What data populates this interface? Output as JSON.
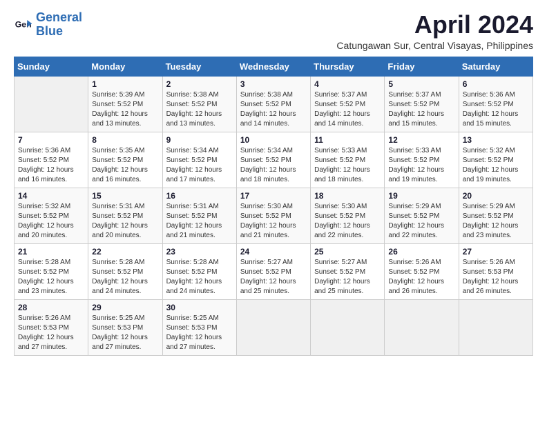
{
  "header": {
    "logo_line1": "General",
    "logo_line2": "Blue",
    "title": "April 2024",
    "subtitle": "Catungawan Sur, Central Visayas, Philippines"
  },
  "calendar": {
    "days_of_week": [
      "Sunday",
      "Monday",
      "Tuesday",
      "Wednesday",
      "Thursday",
      "Friday",
      "Saturday"
    ],
    "weeks": [
      [
        {
          "day": "",
          "info": ""
        },
        {
          "day": "1",
          "info": "Sunrise: 5:39 AM\nSunset: 5:52 PM\nDaylight: 12 hours\nand 13 minutes."
        },
        {
          "day": "2",
          "info": "Sunrise: 5:38 AM\nSunset: 5:52 PM\nDaylight: 12 hours\nand 13 minutes."
        },
        {
          "day": "3",
          "info": "Sunrise: 5:38 AM\nSunset: 5:52 PM\nDaylight: 12 hours\nand 14 minutes."
        },
        {
          "day": "4",
          "info": "Sunrise: 5:37 AM\nSunset: 5:52 PM\nDaylight: 12 hours\nand 14 minutes."
        },
        {
          "day": "5",
          "info": "Sunrise: 5:37 AM\nSunset: 5:52 PM\nDaylight: 12 hours\nand 15 minutes."
        },
        {
          "day": "6",
          "info": "Sunrise: 5:36 AM\nSunset: 5:52 PM\nDaylight: 12 hours\nand 15 minutes."
        }
      ],
      [
        {
          "day": "7",
          "info": "Sunrise: 5:36 AM\nSunset: 5:52 PM\nDaylight: 12 hours\nand 16 minutes."
        },
        {
          "day": "8",
          "info": "Sunrise: 5:35 AM\nSunset: 5:52 PM\nDaylight: 12 hours\nand 16 minutes."
        },
        {
          "day": "9",
          "info": "Sunrise: 5:34 AM\nSunset: 5:52 PM\nDaylight: 12 hours\nand 17 minutes."
        },
        {
          "day": "10",
          "info": "Sunrise: 5:34 AM\nSunset: 5:52 PM\nDaylight: 12 hours\nand 18 minutes."
        },
        {
          "day": "11",
          "info": "Sunrise: 5:33 AM\nSunset: 5:52 PM\nDaylight: 12 hours\nand 18 minutes."
        },
        {
          "day": "12",
          "info": "Sunrise: 5:33 AM\nSunset: 5:52 PM\nDaylight: 12 hours\nand 19 minutes."
        },
        {
          "day": "13",
          "info": "Sunrise: 5:32 AM\nSunset: 5:52 PM\nDaylight: 12 hours\nand 19 minutes."
        }
      ],
      [
        {
          "day": "14",
          "info": "Sunrise: 5:32 AM\nSunset: 5:52 PM\nDaylight: 12 hours\nand 20 minutes."
        },
        {
          "day": "15",
          "info": "Sunrise: 5:31 AM\nSunset: 5:52 PM\nDaylight: 12 hours\nand 20 minutes."
        },
        {
          "day": "16",
          "info": "Sunrise: 5:31 AM\nSunset: 5:52 PM\nDaylight: 12 hours\nand 21 minutes."
        },
        {
          "day": "17",
          "info": "Sunrise: 5:30 AM\nSunset: 5:52 PM\nDaylight: 12 hours\nand 21 minutes."
        },
        {
          "day": "18",
          "info": "Sunrise: 5:30 AM\nSunset: 5:52 PM\nDaylight: 12 hours\nand 22 minutes."
        },
        {
          "day": "19",
          "info": "Sunrise: 5:29 AM\nSunset: 5:52 PM\nDaylight: 12 hours\nand 22 minutes."
        },
        {
          "day": "20",
          "info": "Sunrise: 5:29 AM\nSunset: 5:52 PM\nDaylight: 12 hours\nand 23 minutes."
        }
      ],
      [
        {
          "day": "21",
          "info": "Sunrise: 5:28 AM\nSunset: 5:52 PM\nDaylight: 12 hours\nand 23 minutes."
        },
        {
          "day": "22",
          "info": "Sunrise: 5:28 AM\nSunset: 5:52 PM\nDaylight: 12 hours\nand 24 minutes."
        },
        {
          "day": "23",
          "info": "Sunrise: 5:28 AM\nSunset: 5:52 PM\nDaylight: 12 hours\nand 24 minutes."
        },
        {
          "day": "24",
          "info": "Sunrise: 5:27 AM\nSunset: 5:52 PM\nDaylight: 12 hours\nand 25 minutes."
        },
        {
          "day": "25",
          "info": "Sunrise: 5:27 AM\nSunset: 5:52 PM\nDaylight: 12 hours\nand 25 minutes."
        },
        {
          "day": "26",
          "info": "Sunrise: 5:26 AM\nSunset: 5:52 PM\nDaylight: 12 hours\nand 26 minutes."
        },
        {
          "day": "27",
          "info": "Sunrise: 5:26 AM\nSunset: 5:53 PM\nDaylight: 12 hours\nand 26 minutes."
        }
      ],
      [
        {
          "day": "28",
          "info": "Sunrise: 5:26 AM\nSunset: 5:53 PM\nDaylight: 12 hours\nand 27 minutes."
        },
        {
          "day": "29",
          "info": "Sunrise: 5:25 AM\nSunset: 5:53 PM\nDaylight: 12 hours\nand 27 minutes."
        },
        {
          "day": "30",
          "info": "Sunrise: 5:25 AM\nSunset: 5:53 PM\nDaylight: 12 hours\nand 27 minutes."
        },
        {
          "day": "",
          "info": ""
        },
        {
          "day": "",
          "info": ""
        },
        {
          "day": "",
          "info": ""
        },
        {
          "day": "",
          "info": ""
        }
      ]
    ]
  }
}
